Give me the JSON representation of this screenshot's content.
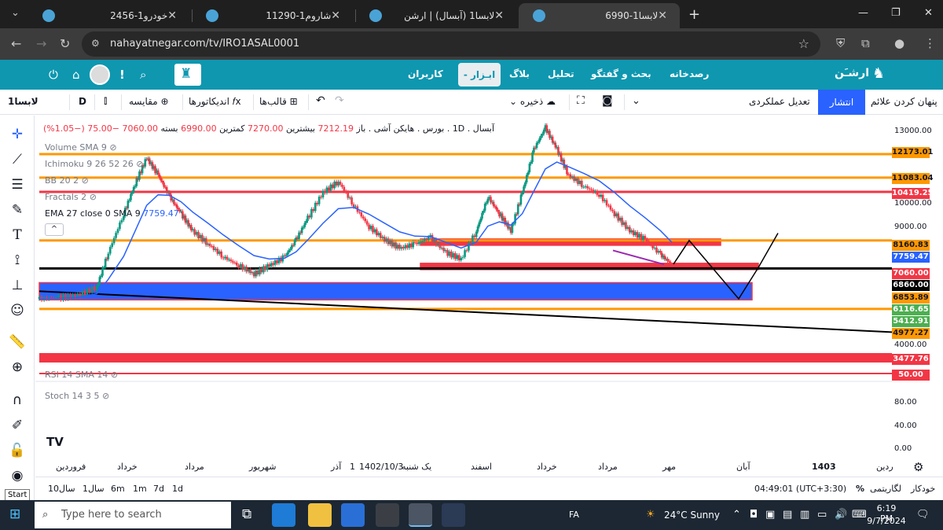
{
  "browser": {
    "tabs": [
      {
        "title": "خودرو1-2456",
        "active": false
      },
      {
        "title": "شاروم1-11290",
        "active": false
      },
      {
        "title": "لابسا1 (آبسال) | ارشن",
        "active": false
      },
      {
        "title": "لابسا1-6990",
        "active": true
      }
    ],
    "url": "nahayatnegar.com/tv/IRO1ASAL0001",
    "new_tab": "+",
    "close": "✕"
  },
  "site_header": {
    "brand": "ارشـَن",
    "menu": [
      "رصدخانه",
      "بحث و گفتگو",
      "تحلیل",
      "بلاگ",
      "ابـزار -",
      "کاربران"
    ]
  },
  "toolbar": {
    "symbol": "لابسا1",
    "interval": "D",
    "compare": "مقایسه",
    "indicators": "اندیکاتورها",
    "templates": "قالب‌ها",
    "save": "ذخیره",
    "performance": "تعدیل عملکردی",
    "publish": "انتشار",
    "hide_markers": "پنهان کردن علائم"
  },
  "legend": {
    "main_prefix": "آبسال . 1D . بورس . هایکن آشی . باز",
    "open": "7212.19",
    "high_label": "بیشترین",
    "high": "7270.00",
    "low_label": "کمترین",
    "low": "6990.00",
    "close_label": "بسته",
    "close": "7060.00",
    "change": "−75.00 (−1.05%)",
    "studies": [
      "Volume SMA 9",
      "Ichimoku 9 26 52 26",
      "BB 20 2",
      "Fractals 2"
    ],
    "ema_line": "EMA 27 close 0 SMA 9",
    "ema_value": "7759.47",
    "rsi": "RSI 14 SMA 14",
    "stoch": "Stoch 14 3 5",
    "collapse": "^"
  },
  "price_axis": {
    "ticks": [
      "13000.00",
      "10000.00",
      "9000.00",
      "4000.00"
    ],
    "osc_ticks": [
      "80.00",
      "40.00",
      "0.00"
    ],
    "tags": [
      {
        "value": "12173.01",
        "color": "#ff9800"
      },
      {
        "value": "11083.04",
        "color": "#ff9800"
      },
      {
        "value": "10419.25",
        "color": "#f23645"
      },
      {
        "value": "8160.83",
        "color": "#ff9800"
      },
      {
        "value": "7759.47",
        "color": "#2962ff"
      },
      {
        "value": "7060.00",
        "color": "#f23645"
      },
      {
        "value": "6860.00",
        "color": "#000000"
      },
      {
        "value": "6853.89",
        "color": "#ff9800"
      },
      {
        "value": "6116.65",
        "color": "#4caf50"
      },
      {
        "value": "5412.91",
        "color": "#4caf50"
      },
      {
        "value": "4977.27",
        "color": "#ff9800"
      },
      {
        "value": "3477.76",
        "color": "#f23645"
      },
      {
        "value": "50.00",
        "color": "#f23645"
      }
    ]
  },
  "time_axis": [
    "فروردین",
    "خرداد",
    "مرداد",
    "شهریور",
    "آذر",
    "1",
    "1402/10/3",
    "یک شنبه",
    "اسفند",
    "خرداد",
    "مرداد",
    "مهر",
    "آبان",
    "1403",
    "ردین"
  ],
  "range_bar": {
    "ranges": [
      "10سال",
      "1سال",
      "6m",
      "1m",
      "7d",
      "1d"
    ],
    "clock": "04:49:01 (UTC+3:30)",
    "percent": "%",
    "log": "لگاریتمی",
    "auto": "خودکار"
  },
  "taskbar": {
    "search_placeholder": "Type here to search",
    "language": "FA",
    "weather": "24°C  Sunny",
    "time": "6:19 PM",
    "date": "9/7/2024",
    "start_tip": "Start"
  },
  "chart_data": {
    "type": "candlestick",
    "ylim": [
      3000,
      13600
    ],
    "ohlc_approx": [
      [
        0,
        5450
      ],
      [
        5,
        5500
      ],
      [
        10,
        5600
      ],
      [
        15,
        6000
      ],
      [
        18,
        7600
      ],
      [
        22,
        9400
      ],
      [
        25,
        10800
      ],
      [
        28,
        12000
      ],
      [
        31,
        11200
      ],
      [
        34,
        10200
      ],
      [
        37,
        9400
      ],
      [
        40,
        8600
      ],
      [
        44,
        8000
      ],
      [
        48,
        7400
      ],
      [
        52,
        7000
      ],
      [
        56,
        6600
      ],
      [
        60,
        7000
      ],
      [
        64,
        7400
      ],
      [
        67,
        8200
      ],
      [
        70,
        9200
      ],
      [
        74,
        10400
      ],
      [
        78,
        10900
      ],
      [
        82,
        9800
      ],
      [
        86,
        8800
      ],
      [
        90,
        8200
      ],
      [
        94,
        7800
      ],
      [
        98,
        8000
      ],
      [
        102,
        8300
      ],
      [
        106,
        7600
      ],
      [
        110,
        7300
      ],
      [
        114,
        8600
      ],
      [
        117,
        10200
      ],
      [
        120,
        9400
      ],
      [
        123,
        8600
      ],
      [
        126,
        10400
      ],
      [
        129,
        12400
      ],
      [
        132,
        13400
      ],
      [
        135,
        12400
      ],
      [
        138,
        11200
      ],
      [
        142,
        10700
      ],
      [
        146,
        10300
      ],
      [
        150,
        9400
      ],
      [
        154,
        8600
      ],
      [
        158,
        8200
      ],
      [
        162,
        7500
      ],
      [
        165,
        7060
      ]
    ],
    "horizontal_levels": [
      12173.01,
      11083.04,
      10419.25,
      8160.83,
      6860.0,
      4977.27
    ],
    "zones": [
      {
        "from": 8100,
        "to": 8230,
        "color": "#f23645"
      },
      {
        "from": 6900,
        "to": 7100,
        "color": "#f23645"
      },
      {
        "from": 5400,
        "to": 6200,
        "color": "#2962ff"
      }
    ],
    "ema_last": 7759.47
  }
}
